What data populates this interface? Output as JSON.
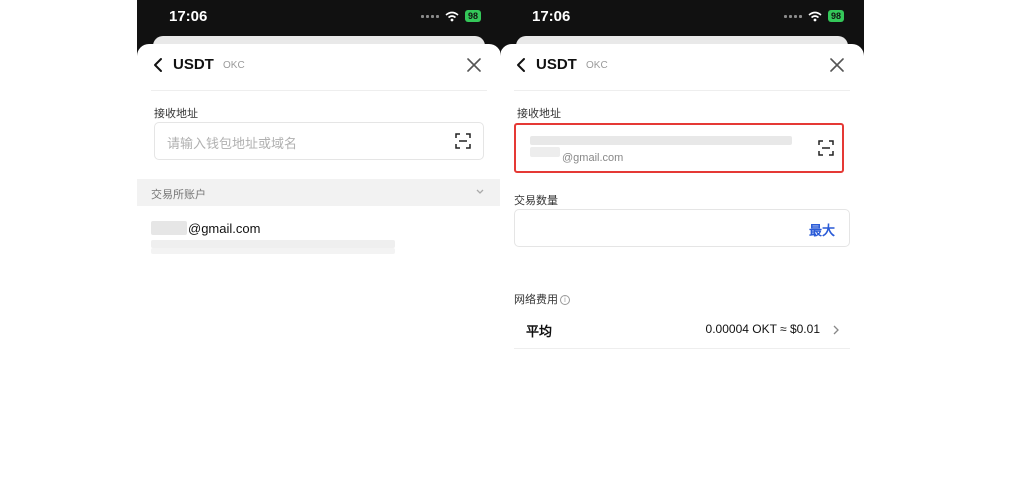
{
  "left": {
    "status": {
      "time": "17:06",
      "battery": "98"
    },
    "header": {
      "title": "USDT",
      "network": "OKC"
    },
    "address": {
      "label": "接收地址",
      "placeholder": "请输入钱包地址或域名"
    },
    "accounts": {
      "section_label": "交易所账户",
      "items": [
        {
          "email": "@gmail.com"
        }
      ]
    }
  },
  "right": {
    "status": {
      "time": "17:06",
      "battery": "98"
    },
    "header": {
      "title": "USDT",
      "network": "OKC"
    },
    "address": {
      "label": "接收地址",
      "email_suffix": "@gmail.com"
    },
    "amount": {
      "label": "交易数量",
      "max_label": "最大"
    },
    "fee": {
      "label": "网络费用",
      "speed": "平均",
      "amount": "0.00004 OKT ≈ $0.01"
    }
  },
  "colors": {
    "accent_blue": "#2a5bd7",
    "highlight_red": "#e53935",
    "battery_green": "#34c759"
  },
  "icons": [
    "back-arrow-icon",
    "close-icon",
    "scan-icon",
    "chevron-down-icon",
    "chevron-right-icon",
    "info-icon",
    "wifi-icon",
    "signal-icon",
    "battery-icon"
  ]
}
